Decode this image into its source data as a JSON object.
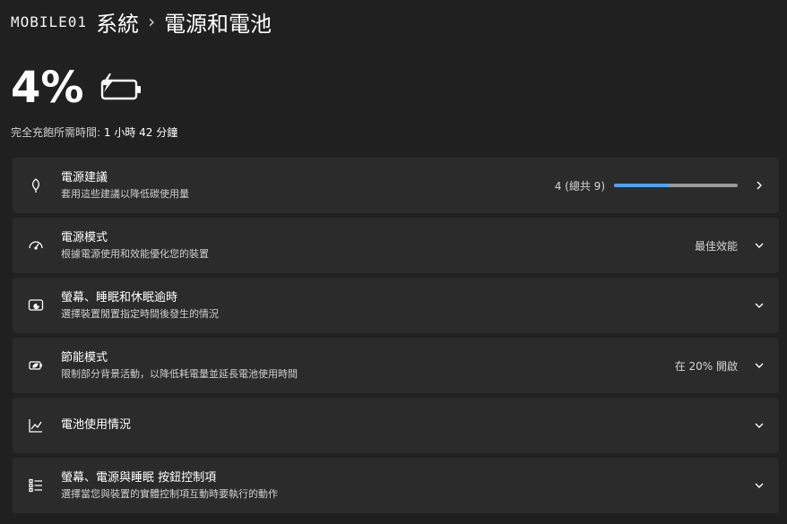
{
  "header": {
    "watermark": "MOBILE01",
    "breadcrumb_root": "系統",
    "separator": "›",
    "page_title": "電源和電池"
  },
  "battery": {
    "percent_text": "4%",
    "charge_label": "完全充飽所需時間:",
    "charge_value": "1 小時 42 分鐘"
  },
  "cards": [
    {
      "icon": "leaf-icon",
      "title": "電源建議",
      "subtitle": "套用這些建議以降低碳使用量",
      "right_text": "4 (總共 9)",
      "progress_fraction": 0.444,
      "chevron": "chevron-right-icon"
    },
    {
      "icon": "power-mode-icon",
      "title": "電源模式",
      "subtitle": "根據電源使用和效能優化您的裝置",
      "right_text": "最佳效能",
      "chevron": "chevron-down-icon"
    },
    {
      "icon": "screen-sleep-icon",
      "title": "螢幕、睡眠和休眠逾時",
      "subtitle": "選擇裝置閒置指定時間後發生的情況",
      "chevron": "chevron-down-icon"
    },
    {
      "icon": "battery-saver-icon",
      "title": "節能模式",
      "subtitle": "限制部分背景活動，以降低耗電量並延長電池使用時間",
      "right_text": "在 20% 開啟",
      "chevron": "chevron-down-icon"
    },
    {
      "icon": "chart-icon",
      "title": "電池使用情況",
      "chevron": "chevron-down-icon"
    },
    {
      "icon": "list-icon",
      "title": "螢幕、電源與睡眠 按鈕控制項",
      "subtitle": "選擇當您與裝置的實體控制項互動時要執行的動作",
      "chevron": "chevron-down-icon"
    }
  ],
  "colors": {
    "background": "#202020",
    "card": "#2b2b2b",
    "accent": "#4aa3ff"
  }
}
